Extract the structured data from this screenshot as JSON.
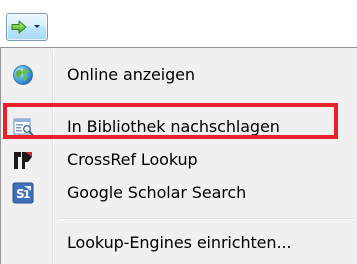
{
  "toolbar": {
    "lookup_button_icon": "green-arrow-right-icon",
    "dropdown_icon": "chevron-down-icon"
  },
  "menu": {
    "items": [
      {
        "label": "Online anzeigen",
        "icon": "globe-icon"
      },
      {
        "label": "In Bibliothek nachschlagen",
        "icon": "library-catalog-icon",
        "highlighted": true
      },
      {
        "label": "CrossRef Lookup",
        "icon": "crossref-icon"
      },
      {
        "label": "Google Scholar Search",
        "icon": "google-scholar-icon"
      },
      {
        "label": "Lookup-Engines einrichten...",
        "icon": ""
      }
    ]
  },
  "colors": {
    "highlight_border": "#e8212a",
    "menu_background": "#f0f0f0",
    "button_border": "#7c9ab7"
  }
}
